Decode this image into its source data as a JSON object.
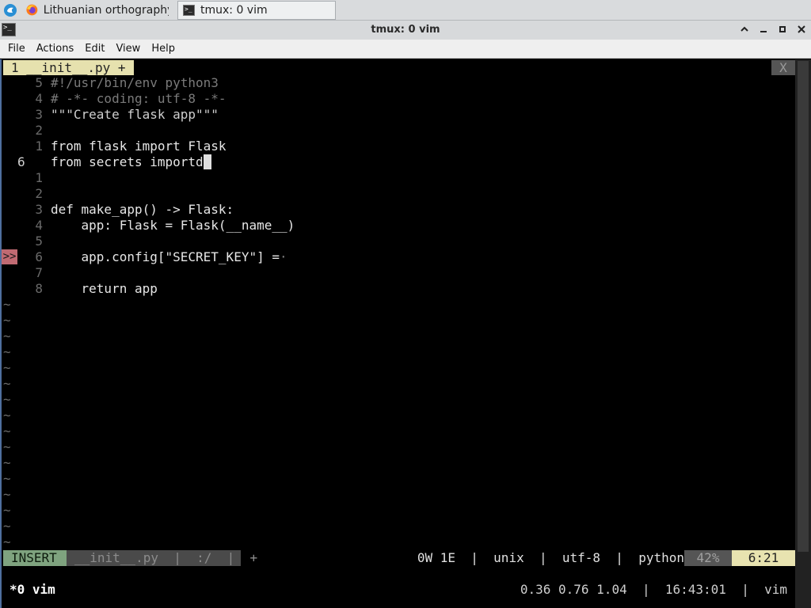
{
  "taskbar": {
    "tasks": [
      {
        "label": "Lithuanian orthography ...",
        "icon": "firefox-icon"
      },
      {
        "label": "tmux: 0 vim",
        "icon": "terminal-icon"
      }
    ]
  },
  "window": {
    "title": "tmux: 0 vim",
    "controls": [
      "minimize",
      "restore",
      "maximize",
      "close"
    ]
  },
  "menu": [
    "File",
    "Actions",
    "Edit",
    "View",
    "Help"
  ],
  "vim": {
    "tab": {
      "label": "1  __init__.py +",
      "close": "X"
    },
    "lines": [
      {
        "num": "5",
        "text": "#!/usr/bin/env python3",
        "cls": "c-comment"
      },
      {
        "num": "4",
        "text": "# -*- coding: utf-8 -*-",
        "cls": "c-comment"
      },
      {
        "num": "3",
        "text": "\"\"\"Create flask app\"\"\"",
        "cls": "c-string"
      },
      {
        "num": "2",
        "text": "",
        "cls": ""
      },
      {
        "num": "1",
        "text": "from flask import Flask",
        "cls": ""
      },
      {
        "num": "6",
        "text": "from secrets importd",
        "cls": "",
        "current": true
      },
      {
        "num": "1",
        "text": "",
        "cls": ""
      },
      {
        "num": "2",
        "text": "",
        "cls": ""
      },
      {
        "num": "3",
        "text": "def make_app() -> Flask:",
        "cls": ""
      },
      {
        "num": "4",
        "text": "    app: Flask = Flask(__name__)",
        "cls": ""
      },
      {
        "num": "5",
        "text": "",
        "cls": ""
      },
      {
        "num": "6",
        "text": "    app.config[\"SECRET_KEY\"] =",
        "cls": "",
        "sign": ">>",
        "trail": "·"
      },
      {
        "num": "7",
        "text": "",
        "cls": ""
      },
      {
        "num": "8",
        "text": "    return app",
        "cls": ""
      }
    ],
    "tilde_count": 16,
    "tilde": "~",
    "status": {
      "mode": "INSERT",
      "file": "__init__.py  |  :/  |  +",
      "info": "0W 1E  |  unix  |  utf-8  |  python",
      "percent": "42%",
      "position": "6:21"
    }
  },
  "tmux": {
    "window": "*0 vim",
    "right": "0.36 0.76 1.04  |  16:43:01  |  vim"
  }
}
